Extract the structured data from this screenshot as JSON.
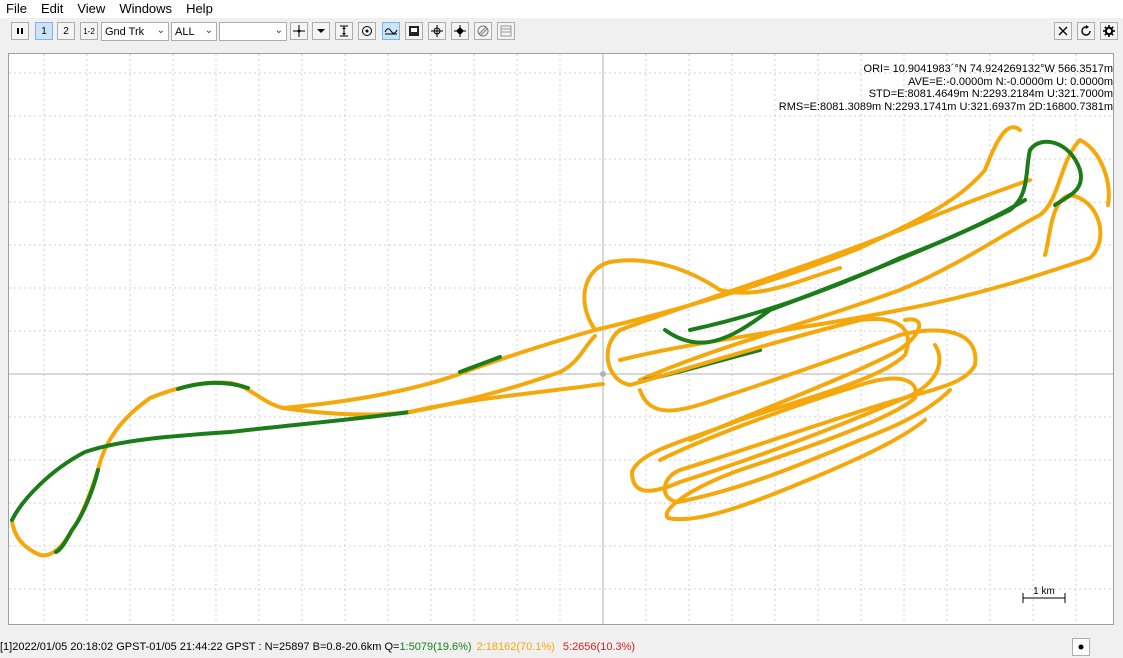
{
  "menu": {
    "items": [
      "File",
      "Edit",
      "View",
      "Windows",
      "Help"
    ]
  },
  "toolbar": {
    "plot_mode_1": "1",
    "plot_mode_2": "2",
    "plot_mode_12": "1-2",
    "plot_type": "Gnd Trk",
    "quality_filter": "ALL",
    "satellite": ""
  },
  "stats": {
    "ori": "ORI= 10.9041983´°N   74.924269132°W 566.3517m",
    "ave": "AVE=E:-0.0000m N:-0.0000m U: 0.0000m",
    "std": "STD=E:8081.4649m N:2293.2184m U:321.7000m",
    "rms": "RMS=E:8081.3089m N:2293.1741m U:321.6937m 2D:16800.7381m"
  },
  "scale_label": "1 km",
  "status": {
    "main": "[1]2022/01/05 20:18:02 GPST-01/05 21:44:22 GPST : N=25897 B=0.8-20.6km Q=",
    "q1": "1:5079(19.6%)",
    "q2": "2:18162(70.1%)",
    "q5": "5:2656(10.3%)"
  },
  "colors": {
    "float": "#f5a80b",
    "fix": "#1a7d1a",
    "single": "#e02020",
    "grid": "#c8c8c8"
  }
}
